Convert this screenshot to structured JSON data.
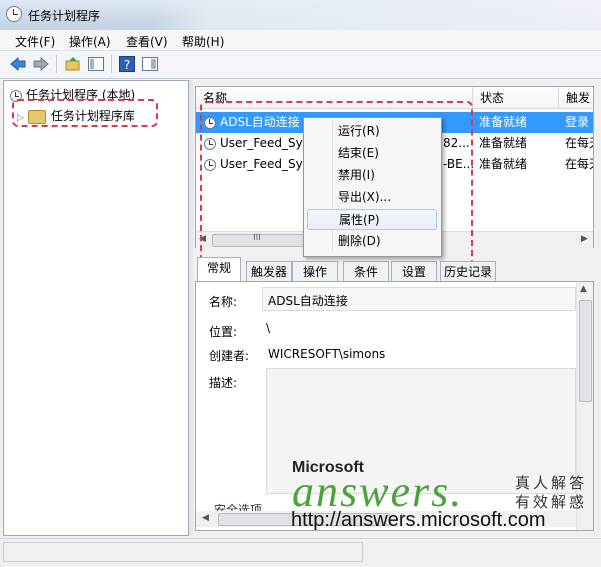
{
  "window": {
    "title": "任务计划程序"
  },
  "menu": [
    "文件(F)",
    "操作(A)",
    "查看(V)",
    "帮助(H)"
  ],
  "tree": {
    "root": "任务计划程序 (本地)",
    "library": "任务计划程序库"
  },
  "list": {
    "columns": [
      "名称",
      "状态",
      "触发"
    ],
    "rows": [
      {
        "name": "ADSL自动连接",
        "mid": "",
        "status": "准备就绪",
        "trigger": "登录"
      },
      {
        "name": "User_Feed_Syn",
        "mid": "82...",
        "status": "准备就绪",
        "trigger": "在每天"
      },
      {
        "name": "User_Feed_Syn",
        "mid": "-BE...",
        "status": "准备就绪",
        "trigger": "在每天"
      }
    ],
    "scroll_mark": "III"
  },
  "context_menu": [
    "运行(R)",
    "结束(E)",
    "禁用(I)",
    "导出(X)...",
    "属性(P)",
    "删除(D)"
  ],
  "tabs": [
    "常规",
    "触发器",
    "操作",
    "条件",
    "设置",
    "历史记录"
  ],
  "detail": {
    "name_label": "名称:",
    "name_value": "ADSL自动连接",
    "location_label": "位置:",
    "location_value": "\\",
    "author_label": "创建者:",
    "author_value": "WICRESOFT\\simons",
    "desc_label": "描述:",
    "security_label": "安全选项"
  },
  "watermark": {
    "brand": "Microsoft",
    "word": "answers.",
    "cn_line1": "真人解答",
    "cn_line2": "有效解惑",
    "url": "http://answers.microsoft.com"
  },
  "colors": {
    "selection": "#3399ff",
    "highlight_box": "#e0384a",
    "watermark_green": "#4aa33a"
  }
}
